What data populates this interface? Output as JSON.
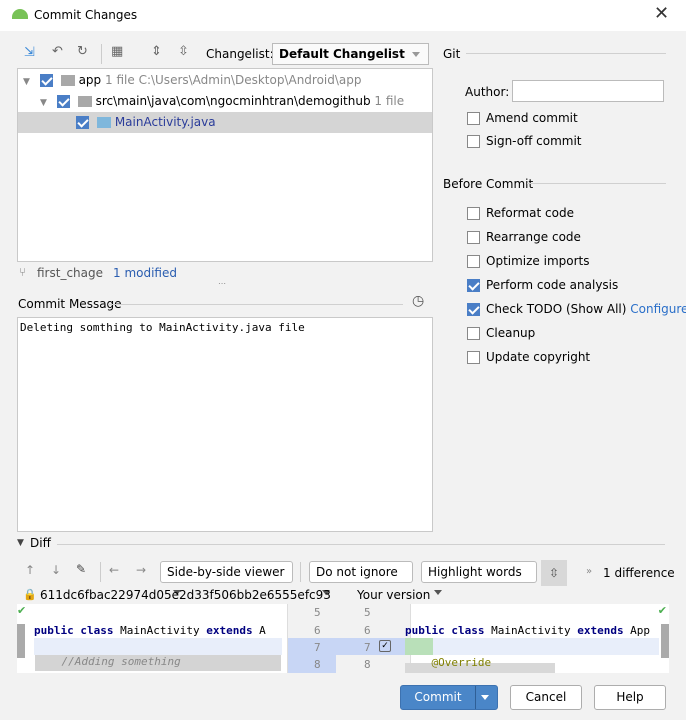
{
  "window": {
    "title": "Commit Changes",
    "close": "✕"
  },
  "toolbar": {
    "changelist_label": "Changelist:",
    "changelist_value": "Default Changelist"
  },
  "tree": [
    {
      "name": "app",
      "count": "1 file",
      "path": "C:\\Users\\Admin\\Desktop\\Android\\app"
    },
    {
      "name": "src\\main\\java\\com\\ngocminhtran\\demogithub",
      "count": "1 file"
    },
    {
      "name": "MainActivity.java"
    }
  ],
  "status": {
    "branch": "first_chage",
    "modified": "1 modified"
  },
  "commit_message": {
    "label": "Commit Message",
    "value": "Deleting somthing to MainActivity.java file"
  },
  "git": {
    "header": "Git",
    "author_label": "Author:",
    "author_value": "",
    "amend": "Amend commit",
    "signoff": "Sign-off commit"
  },
  "before_commit": {
    "header": "Before Commit",
    "options": [
      {
        "label": "Reformat code",
        "checked": false
      },
      {
        "label": "Rearrange code",
        "checked": false
      },
      {
        "label": "Optimize imports",
        "checked": false
      },
      {
        "label": "Perform code analysis",
        "checked": true
      },
      {
        "label": "Check TODO (Show All)",
        "checked": true,
        "link": "Configure"
      },
      {
        "label": "Cleanup",
        "checked": false
      },
      {
        "label": "Update copyright",
        "checked": false
      }
    ]
  },
  "diff": {
    "header": "Diff",
    "viewer": "Side-by-side viewer",
    "ignore": "Do not ignore",
    "highlight": "Highlight words",
    "differences": "1 difference",
    "left_title": "611dc6fbac22974d05e2d33f506bb2e6555efc93",
    "right_title": "Your version",
    "left_lines": [
      "",
      "public class MainActivity extends Ap",
      "",
      "    //Adding something"
    ],
    "right_lines": [
      "",
      "public class MainActivity extends App",
      "",
      "    @Override"
    ],
    "line_numbers": [
      "5",
      "6",
      "7",
      "8"
    ]
  },
  "buttons": {
    "commit": "Commit",
    "cancel": "Cancel",
    "help": "Help"
  }
}
